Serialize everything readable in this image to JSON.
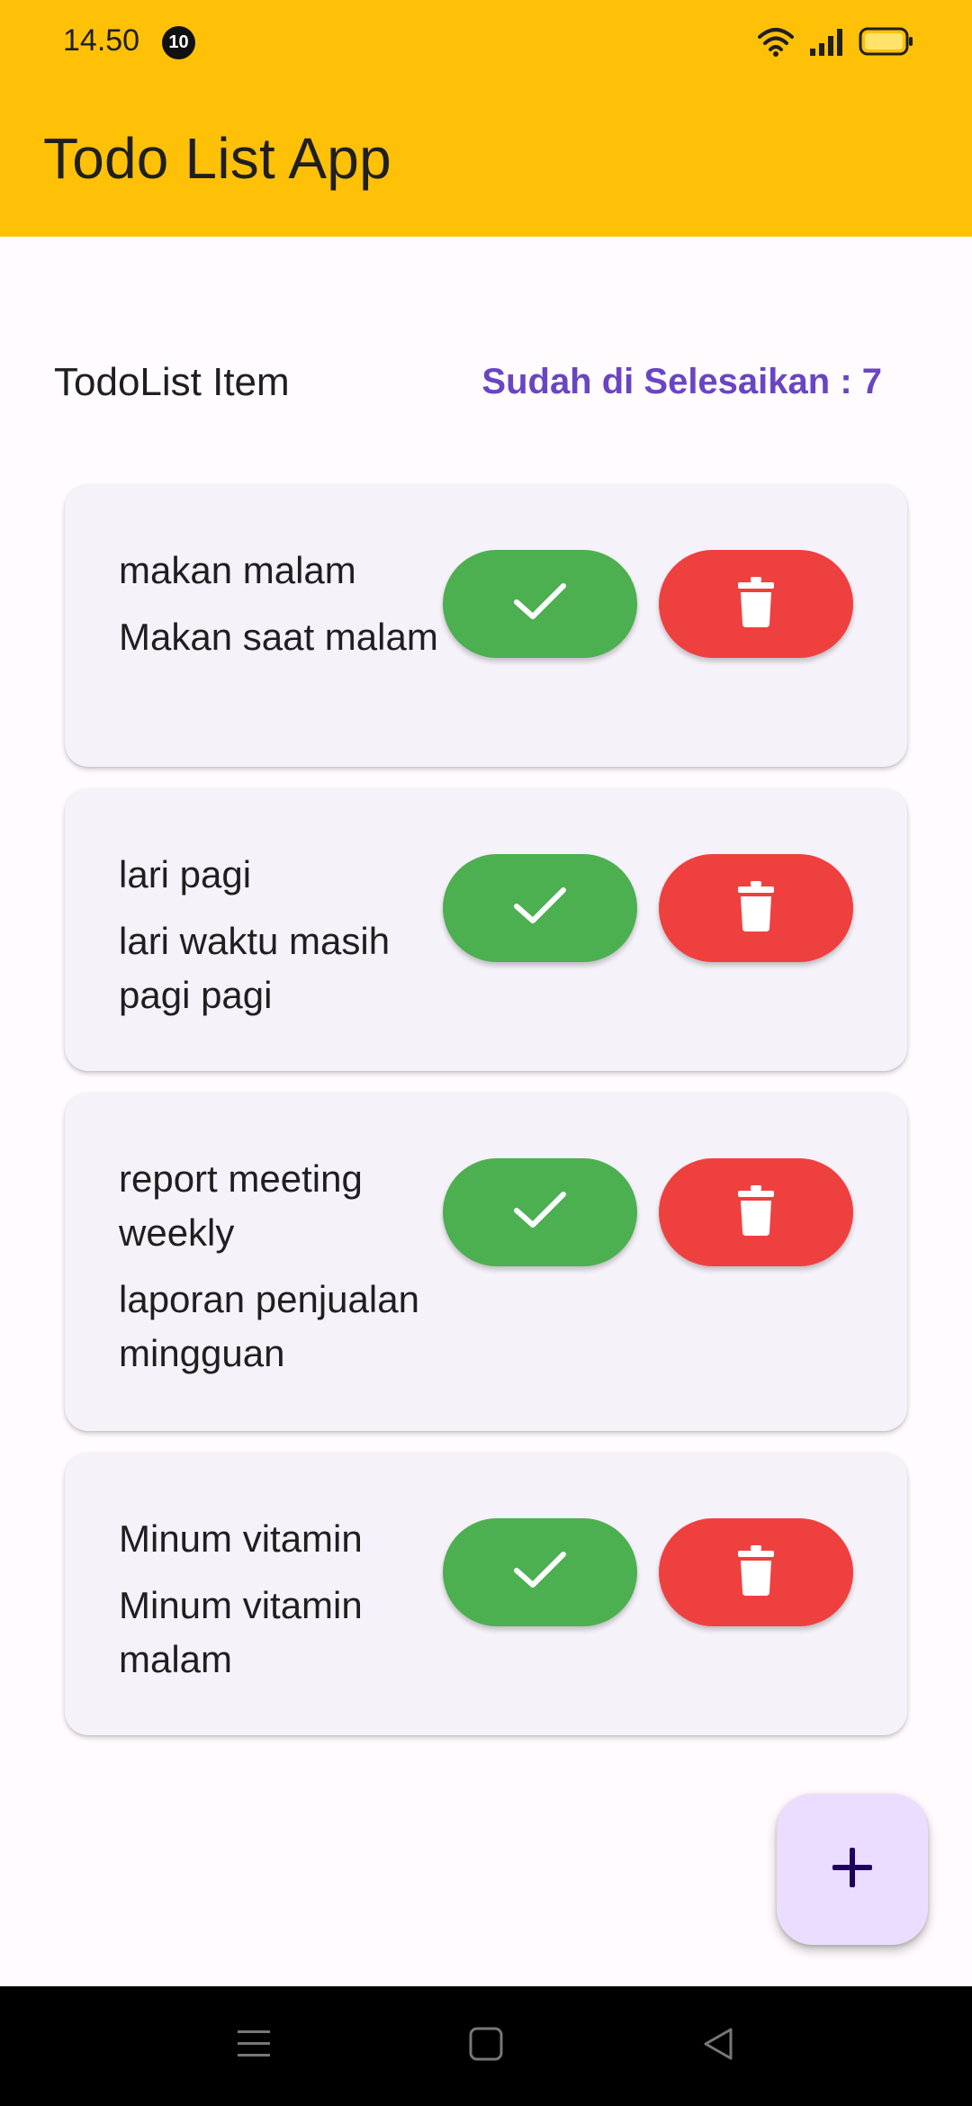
{
  "status_bar": {
    "time": "14.50",
    "notification_count": "10",
    "icons": [
      "wifi-icon",
      "signal-icon",
      "battery-icon"
    ]
  },
  "app_bar": {
    "title": "Todo List App",
    "color": "#FFC107"
  },
  "header": {
    "title": "TodoList Item",
    "completed_label": "Sudah di Selesaikan : 7",
    "completed_color": "#6a45c2"
  },
  "todos": [
    {
      "title": "makan malam",
      "description": "Makan saat malam",
      "done_icon": "check-icon",
      "delete_icon": "trash-icon"
    },
    {
      "title": "lari pagi",
      "description": "lari waktu masih pagi pagi",
      "done_icon": "check-icon",
      "delete_icon": "trash-icon"
    },
    {
      "title": "report meeting weekly",
      "description": "laporan penjualan mingguan",
      "done_icon": "check-icon",
      "delete_icon": "trash-icon"
    },
    {
      "title": "Minum vitamin",
      "description": "Minum vitamin malam",
      "done_icon": "check-icon",
      "delete_icon": "trash-icon"
    }
  ],
  "colors": {
    "done_button": "#4CAF50",
    "delete_button": "#EF4040",
    "card_background": "#F6F2FA",
    "fab_background": "#EADDFF"
  },
  "fab": {
    "icon": "plus-icon"
  },
  "nav_bar": {
    "icons": [
      "menu-icon",
      "home-icon",
      "back-icon"
    ]
  }
}
